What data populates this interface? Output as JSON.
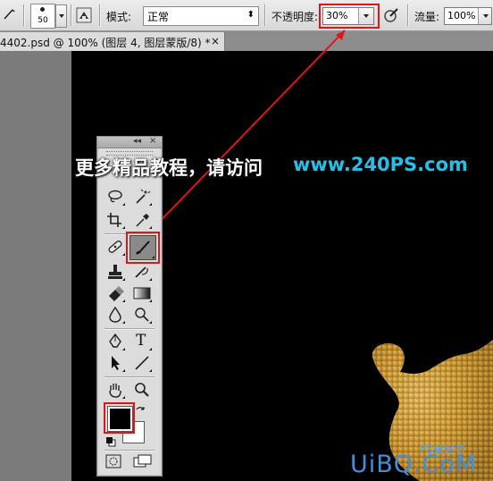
{
  "options_bar": {
    "brush_size": "50",
    "mode_label": "模式:",
    "mode_value": "正常",
    "opacity_label": "不透明度:",
    "opacity_value": "30%",
    "flow_label": "流量:",
    "flow_value": "100%"
  },
  "document_tab": {
    "title": "4402.psd @ 100% (图层 4, 图层蒙版/8) *",
    "close": "×"
  },
  "toolbox": {
    "collapse": "◂◂",
    "close": "×",
    "type_tool_glyph": "T"
  },
  "watermark": {
    "text": "更多精品教程，请访问",
    "url": "www.240PS.com"
  },
  "corner_logo": {
    "text": "UiBQ.CoM",
    "sub": "PS爱好者"
  },
  "colors": {
    "highlight": "#e0151a",
    "foreground": "#000000",
    "background": "#ffffff",
    "watermark_url": "#24c0e8"
  }
}
